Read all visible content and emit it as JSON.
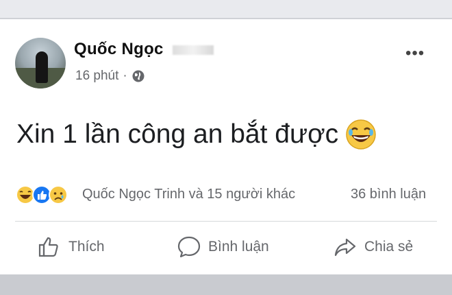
{
  "post": {
    "author": "Quốc Ngọc",
    "time": "16 phút",
    "separator": "·",
    "text": "Xin 1 lần công an bắt được",
    "more": "•••"
  },
  "reactions": {
    "names": "Quốc Ngọc Trinh và 15 người khác",
    "comments": "36 bình luận"
  },
  "actions": {
    "like": "Thích",
    "comment": "Bình luận",
    "share": "Chia sẻ"
  },
  "colors": {
    "secondary_text": "#65676b",
    "like_blue": "#1877f2",
    "emoji_yellow": "#f7c845"
  }
}
